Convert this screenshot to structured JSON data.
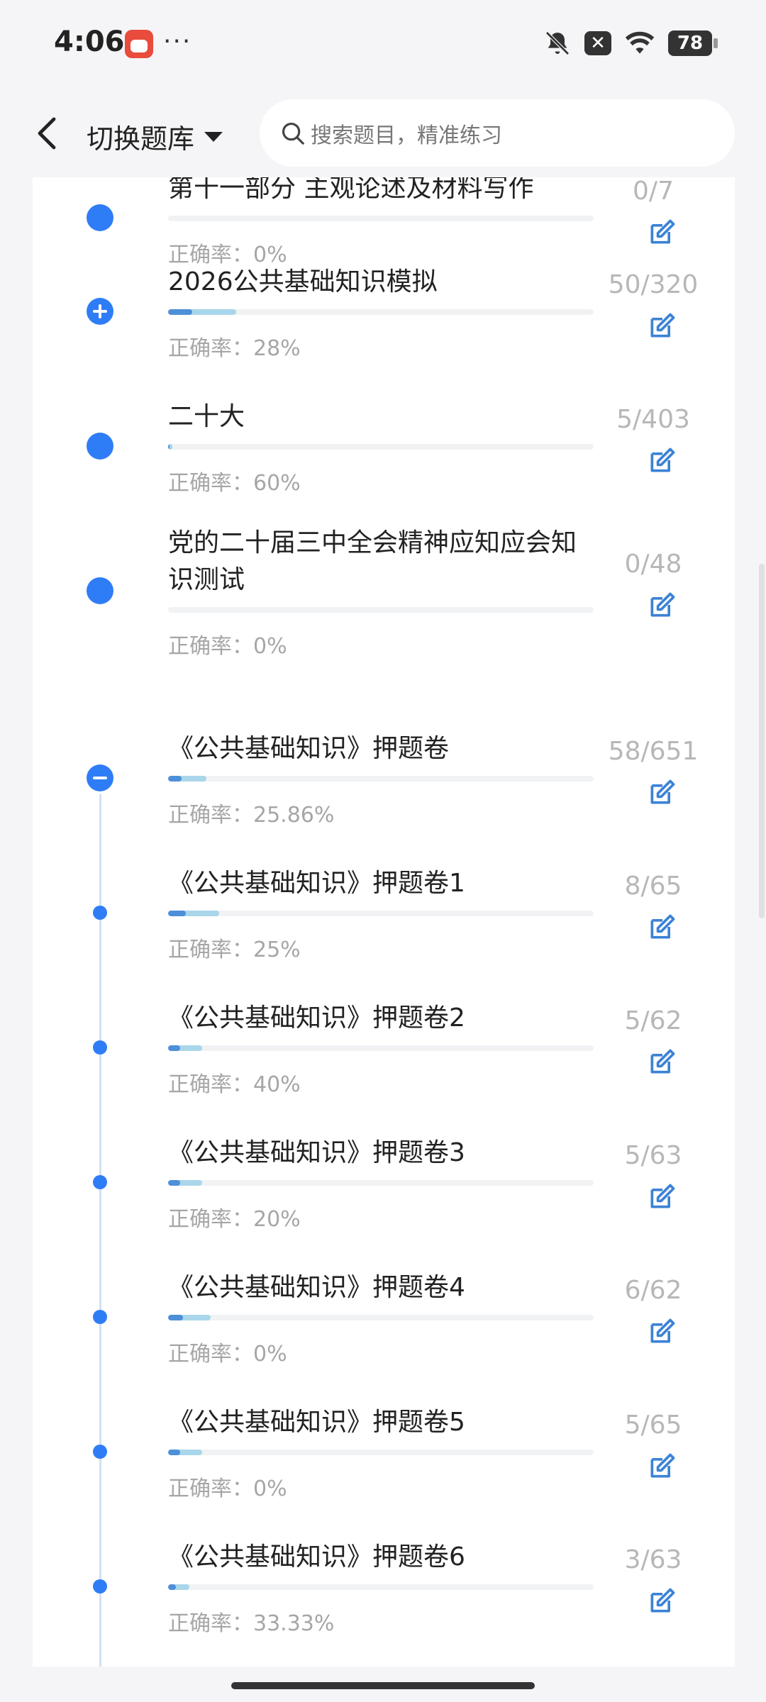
{
  "status_bar": {
    "time": "4:06",
    "dots": "···",
    "battery": "78",
    "x_badge": "✕"
  },
  "header": {
    "switch_label": "切换题库",
    "search_placeholder": "搜索题目，精准练习"
  },
  "rate_prefix": "正确率：",
  "items": [
    {
      "title": "第十一部分 主观论述及材料写作",
      "rate": "0%",
      "count": "0/7",
      "progress": 0.0,
      "marker": "big"
    },
    {
      "title": "2026公共基础知识模拟",
      "rate": "28%",
      "count": "50/320",
      "progress": 0.16,
      "marker": "plus"
    },
    {
      "title": "二十大",
      "rate": "60%",
      "count": "5/403",
      "progress": 0.01,
      "marker": "big"
    },
    {
      "title": "党的二十届三中全会精神应知应会知识测试",
      "rate": "0%",
      "count": "0/48",
      "progress": 0.0,
      "marker": "big"
    },
    {
      "title": "《公共基础知识》押题卷",
      "rate": "25.86%",
      "count": "58/651",
      "progress": 0.09,
      "marker": "minus"
    },
    {
      "title": "《公共基础知识》押题卷1",
      "rate": "25%",
      "count": "8/65",
      "progress": 0.12,
      "marker": "small"
    },
    {
      "title": "《公共基础知识》押题卷2",
      "rate": "40%",
      "count": "5/62",
      "progress": 0.08,
      "marker": "small"
    },
    {
      "title": "《公共基础知识》押题卷3",
      "rate": "20%",
      "count": "5/63",
      "progress": 0.08,
      "marker": "small"
    },
    {
      "title": "《公共基础知识》押题卷4",
      "rate": "0%",
      "count": "6/62",
      "progress": 0.1,
      "marker": "small"
    },
    {
      "title": "《公共基础知识》押题卷5",
      "rate": "0%",
      "count": "5/65",
      "progress": 0.08,
      "marker": "small"
    },
    {
      "title": "《公共基础知识》押题卷6",
      "rate": "33.33%",
      "count": "3/63",
      "progress": 0.05,
      "marker": "small"
    }
  ],
  "colors": {
    "accent": "#2f7df6",
    "bar_light": "#a9d6ea",
    "bar_dark": "#4d8fd8"
  }
}
